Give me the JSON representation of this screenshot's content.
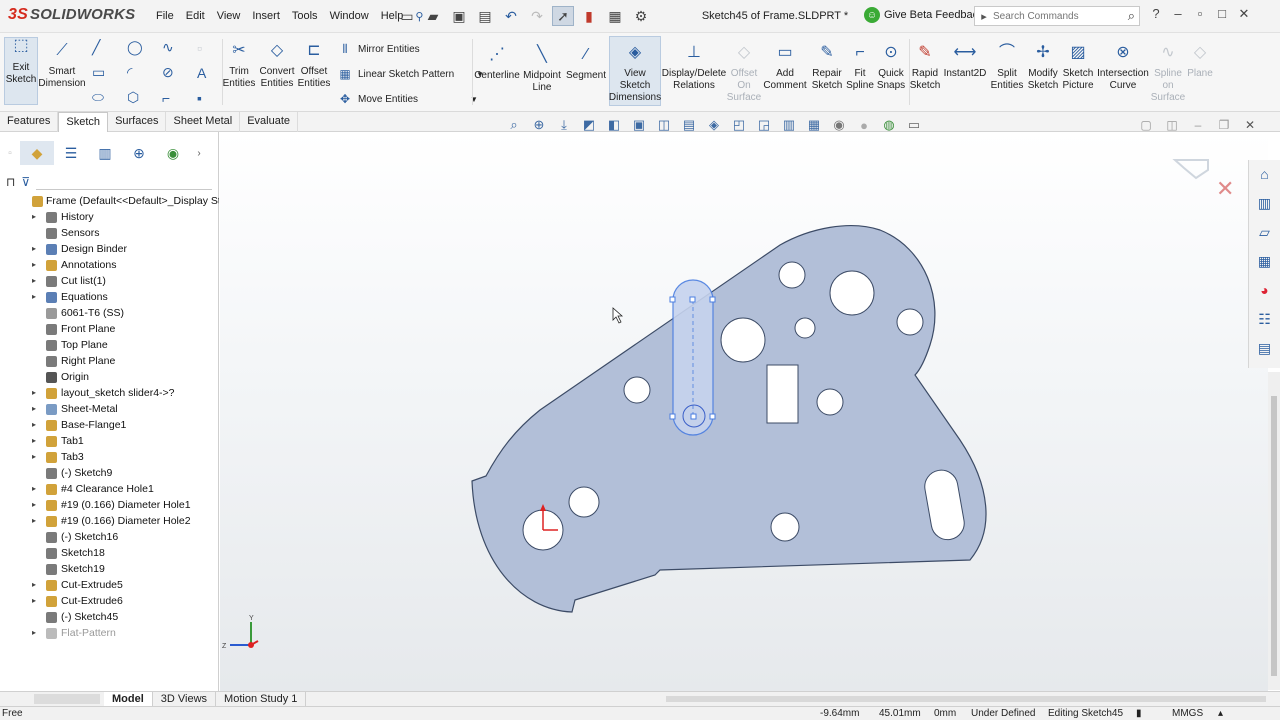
{
  "app": {
    "logo_prefix": "3S",
    "logo_text": "SOLIDWORKS",
    "document_title": "Sketch45 of Frame.SLDPRT *"
  },
  "menu": [
    "File",
    "Edit",
    "View",
    "Insert",
    "Tools",
    "Window",
    "Help"
  ],
  "titlebar": {
    "beta_feedback": "Give Beta Feedback",
    "search_placeholder": "Search Commands"
  },
  "command_manager": {
    "exit_sketch": [
      "Exit",
      "Sketch"
    ],
    "smart_dimension": [
      "Smart",
      "Dimension"
    ],
    "trim_entities": [
      "Trim",
      "Entities"
    ],
    "convert_entities": [
      "Convert",
      "Entities"
    ],
    "offset_entities": [
      "Offset",
      "Entities"
    ],
    "mirror_entities": "Mirror Entities",
    "linear_sketch_pattern": "Linear Sketch Pattern",
    "move_entities": "Move Entities",
    "centerline": "Centerline",
    "midpoint_line": [
      "Midpoint",
      "Line"
    ],
    "segment": "Segment",
    "view_sketch_dimensions": [
      "View",
      "Sketch",
      "Dimensions"
    ],
    "display_delete_relations": [
      "Display/Delete",
      "Relations"
    ],
    "offset_on_surface": [
      "Offset",
      "On",
      "Surface"
    ],
    "add_comment": [
      "Add",
      "Comment"
    ],
    "repair_sketch": [
      "Repair",
      "Sketch"
    ],
    "fit_spline": [
      "Fit",
      "Spline"
    ],
    "quick_snaps": [
      "Quick",
      "Snaps"
    ],
    "rapid_sketch": [
      "Rapid",
      "Sketch"
    ],
    "instant2d": "Instant2D",
    "split_entities": [
      "Split",
      "Entities"
    ],
    "modify_sketch": [
      "Modify",
      "Sketch"
    ],
    "sketch_picture": [
      "Sketch",
      "Picture"
    ],
    "intersection_curve": [
      "Intersection",
      "Curve"
    ],
    "spline_on_surface": [
      "Spline",
      "on",
      "Surface"
    ],
    "plane": "Plane"
  },
  "tabs": [
    {
      "label": "Features",
      "active": false
    },
    {
      "label": "Sketch",
      "active": true
    },
    {
      "label": "Surfaces",
      "active": false
    },
    {
      "label": "Sheet Metal",
      "active": false
    },
    {
      "label": "Evaluate",
      "active": false
    }
  ],
  "tree": {
    "root": "Frame  (Default<<Default>_Display St",
    "items": [
      {
        "label": "History",
        "expandable": true,
        "icon": "history-icon",
        "color": "#7a7a7a"
      },
      {
        "label": "Sensors",
        "expandable": false,
        "icon": "sensor-icon",
        "color": "#7a7a7a"
      },
      {
        "label": "Design Binder",
        "expandable": true,
        "icon": "binder-icon",
        "color": "#5b7fb5"
      },
      {
        "label": "Annotations",
        "expandable": true,
        "icon": "annotation-icon",
        "color": "#d1a23a"
      },
      {
        "label": "Cut list(1)",
        "expandable": true,
        "icon": "cutlist-icon",
        "color": "#7a7a7a"
      },
      {
        "label": "Equations",
        "expandable": true,
        "icon": "equation-icon",
        "color": "#5b7fb5"
      },
      {
        "label": "6061-T6 (SS)",
        "expandable": false,
        "icon": "material-icon",
        "color": "#9a9a9a"
      },
      {
        "label": "Front Plane",
        "expandable": false,
        "icon": "plane-icon",
        "color": "#7a7a7a"
      },
      {
        "label": "Top Plane",
        "expandable": false,
        "icon": "plane-icon",
        "color": "#7a7a7a"
      },
      {
        "label": "Right Plane",
        "expandable": false,
        "icon": "plane-icon",
        "color": "#7a7a7a"
      },
      {
        "label": "Origin",
        "expandable": false,
        "icon": "origin-icon",
        "color": "#555555"
      },
      {
        "label": "layout_sketch slider4->?",
        "expandable": true,
        "icon": "layout-sketch-icon",
        "color": "#d1a23a"
      },
      {
        "label": "Sheet-Metal",
        "expandable": true,
        "icon": "sheet-metal-icon",
        "color": "#7a9bc4"
      },
      {
        "label": "Base-Flange1",
        "expandable": true,
        "icon": "base-flange-icon",
        "color": "#d1a23a"
      },
      {
        "label": "Tab1",
        "expandable": true,
        "icon": "tab-icon",
        "color": "#d1a23a"
      },
      {
        "label": "Tab3",
        "expandable": true,
        "icon": "tab-icon",
        "color": "#d1a23a"
      },
      {
        "label": "(-) Sketch9",
        "expandable": false,
        "icon": "sketch-icon",
        "color": "#7a7a7a"
      },
      {
        "label": "#4 Clearance Hole1",
        "expandable": true,
        "icon": "hole-icon",
        "color": "#d1a23a"
      },
      {
        "label": "#19 (0.166) Diameter Hole1",
        "expandable": true,
        "icon": "hole-icon",
        "color": "#d1a23a"
      },
      {
        "label": "#19 (0.166) Diameter Hole2",
        "expandable": true,
        "icon": "hole-icon",
        "color": "#d1a23a"
      },
      {
        "label": "(-) Sketch16",
        "expandable": false,
        "icon": "sketch-icon",
        "color": "#7a7a7a"
      },
      {
        "label": "Sketch18",
        "expandable": false,
        "icon": "sketch-icon",
        "color": "#7a7a7a"
      },
      {
        "label": "Sketch19",
        "expandable": false,
        "icon": "sketch-icon",
        "color": "#7a7a7a"
      },
      {
        "label": "Cut-Extrude5",
        "expandable": true,
        "icon": "cut-extrude-icon",
        "color": "#d1a23a"
      },
      {
        "label": "Cut-Extrude6",
        "expandable": true,
        "icon": "cut-extrude-icon",
        "color": "#d1a23a"
      },
      {
        "label": "(-) Sketch45",
        "expandable": false,
        "icon": "sketch-icon",
        "color": "#7a7a7a"
      },
      {
        "label": "Flat-Pattern",
        "expandable": true,
        "icon": "flat-pattern-icon",
        "color": "#bbbbbb",
        "dim": true
      }
    ]
  },
  "bottom_tabs": [
    {
      "label": "Model",
      "active": true
    },
    {
      "label": "3D Views",
      "active": false
    },
    {
      "label": "Motion Study 1",
      "active": false
    }
  ],
  "status": {
    "x": "-9.64mm",
    "y": "45.01mm",
    "z": "0mm",
    "state": "Under Defined",
    "editing": "Editing Sketch45",
    "units": "MMGS",
    "ready": "Free"
  },
  "colors": {
    "part_fill": "#b2bfd8",
    "part_edge": "#3c4b66",
    "selected": "#4a7de0",
    "accent": "#2a5d9f"
  }
}
